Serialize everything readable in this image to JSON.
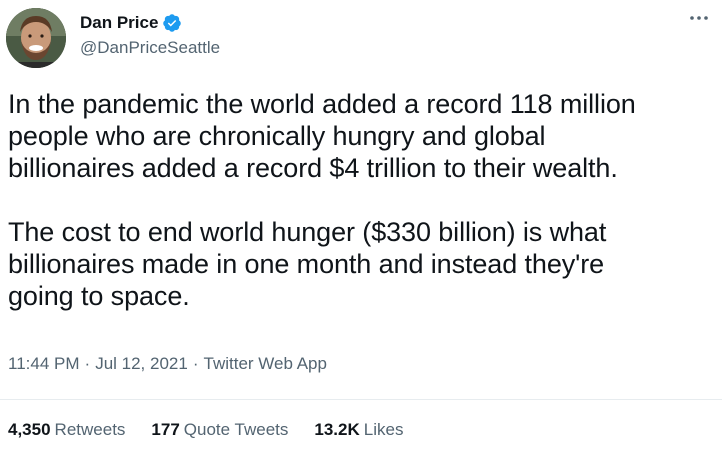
{
  "author": {
    "name": "Dan Price",
    "handle": "@DanPriceSeattle",
    "verified": true,
    "verified_color": "#1d9bf0"
  },
  "tweet": {
    "paragraph_1": "In the pandemic the world added a record 118 million\npeople who are chronically hungry and global\nbillionaires added a record $4 trillion to their wealth.",
    "paragraph_2": "The cost to end world hunger ($330 billion) is what\nbillionaires made in one month and instead they're\ngoing to space."
  },
  "meta": {
    "time": "11:44 PM",
    "separator": "·",
    "date": "Jul 12, 2021",
    "source": "Twitter Web App"
  },
  "stats": {
    "retweets_count": "4,350",
    "retweets_label": "Retweets",
    "quotes_count": "177",
    "quotes_label": "Quote Tweets",
    "likes_count": "13.2K",
    "likes_label": "Likes"
  },
  "icons": {
    "more": "more-horizontal-icon",
    "verified": "verified-badge-icon"
  },
  "colors": {
    "text_primary": "#0f1419",
    "text_secondary": "#536471",
    "divider": "#e7ecef"
  }
}
